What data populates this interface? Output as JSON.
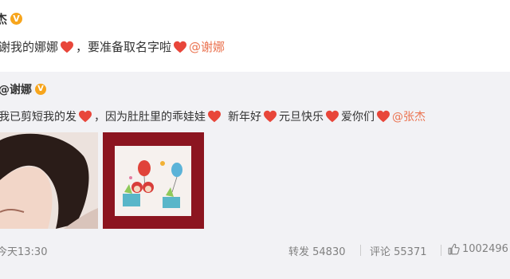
{
  "post": {
    "author": "杰",
    "text_part1": "谢我的娜娜",
    "text_part2": "，要准备取名字啦",
    "mention": "@谢娜"
  },
  "repost": {
    "author": "@谢娜",
    "text_part1": "我已剪短我的发",
    "text_part2": "，因为肚肚里的乖娃娃",
    "text_part3": "新年好",
    "text_part4": "元旦快乐",
    "text_part5": "爱你们",
    "mention": "@张杰"
  },
  "footer": {
    "time": "今天13:30",
    "repost_label": "转发 54830",
    "comment_label": "评论 55371",
    "like_count": "1002496"
  },
  "colors": {
    "heart": "#e8463a",
    "mention": "#eb7350",
    "vip_badge": "#f7a51c",
    "repost_bg": "#f2f2f5"
  }
}
